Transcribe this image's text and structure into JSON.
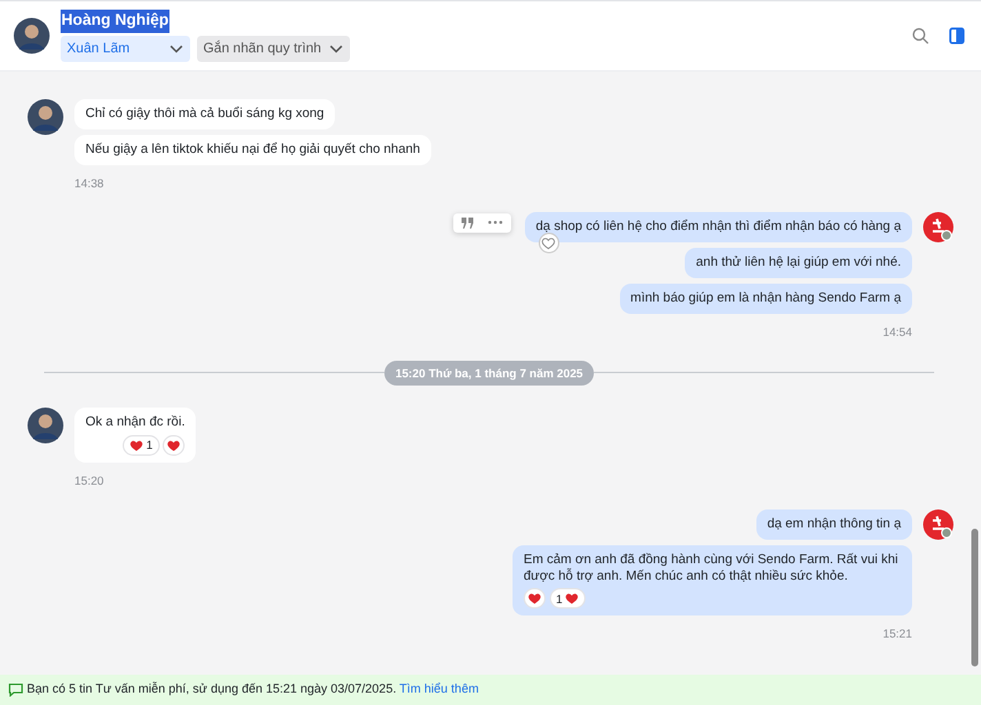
{
  "header": {
    "name": "Hoàng Nghiệp",
    "name_selected": true,
    "assignee": "Xuân Lãm",
    "label_dropdown": "Gắn nhãn quy trình"
  },
  "timeline": [
    {
      "kind": "incoming",
      "time": "14:38",
      "messages": [
        {
          "text": "Chỉ có giậy thôi mà cả buổi sáng kg xong"
        },
        {
          "text": "Nếu giậy a lên tiktok khiếu nại để họ giải quyết cho nhanh"
        }
      ]
    },
    {
      "kind": "outgoing",
      "time": "14:54",
      "messages": [
        {
          "text": "dạ shop có liên hệ cho điểm nhận thì điểm nhận báo có hàng ạ",
          "hovered": true
        },
        {
          "text": "anh thử liên hệ lại giúp em với nhé."
        },
        {
          "text": "mình báo giúp em là nhận hàng Sendo Farm ạ"
        }
      ]
    },
    {
      "kind": "divider",
      "text": "15:20 Thứ ba, 1 tháng 7 năm 2025"
    },
    {
      "kind": "incoming",
      "time": "15:20",
      "messages": [
        {
          "text": "Ok a nhận đc rồi.",
          "reactions": [
            {
              "kind": "count-after",
              "count": "1"
            },
            {
              "kind": "single"
            }
          ]
        }
      ]
    },
    {
      "kind": "outgoing",
      "time": "15:21",
      "messages": [
        {
          "text": "dạ em nhận thông tin ạ"
        },
        {
          "text": "Em cảm ơn anh đã đồng hành cùng với Sendo Farm. Rất vui khi được hỗ trợ anh. Mến chúc anh có thật nhiều sức khỏe.",
          "reactions": [
            {
              "kind": "single"
            },
            {
              "kind": "count-before",
              "count": "1"
            }
          ]
        }
      ]
    }
  ],
  "footer": {
    "notice": "Bạn có 5 tin Tư vấn miễn phí, sử dụng đến 15:21 ngày 03/07/2025.",
    "link": "Tìm hiểu thêm"
  }
}
